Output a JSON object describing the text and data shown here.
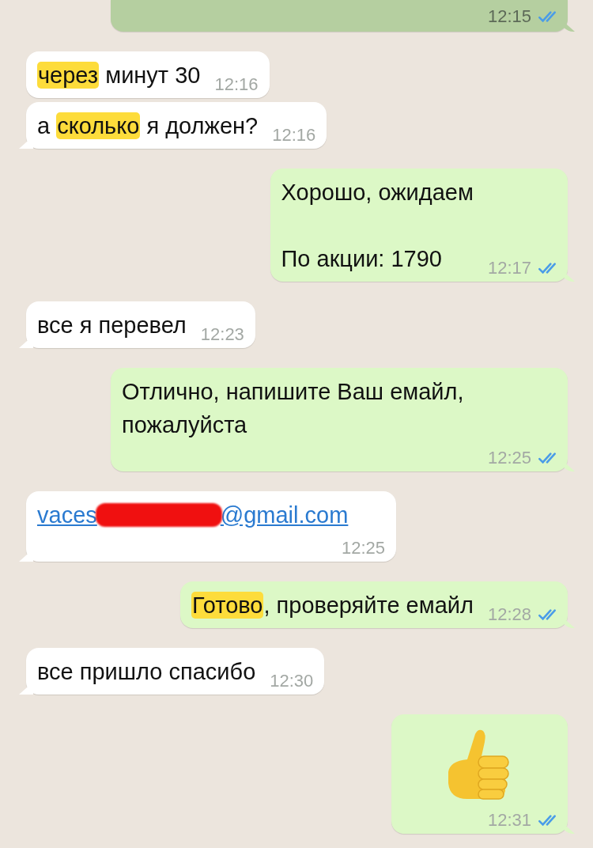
{
  "messages": [
    {
      "outgoing": true,
      "kind": "text",
      "selected": true,
      "time": "12:15",
      "read": true
    },
    {
      "outgoing": false,
      "kind": "text",
      "selected": false,
      "segments": [
        {
          "text": "через",
          "highlight": true
        },
        {
          "text": " минут 30",
          "highlight": false
        }
      ],
      "time": "12:16"
    },
    {
      "outgoing": false,
      "kind": "text",
      "selected": false,
      "segments": [
        {
          "text": "а ",
          "highlight": false
        },
        {
          "text": "сколько",
          "highlight": true
        },
        {
          "text": " я должен?",
          "highlight": false
        }
      ],
      "time": "12:16"
    },
    {
      "outgoing": true,
      "kind": "text",
      "selected": false,
      "segments": [
        {
          "text": "Хорошо, ожидаем\n\nПо акции: 1790",
          "highlight": false
        }
      ],
      "time": "12:17",
      "read": true
    },
    {
      "outgoing": false,
      "kind": "text",
      "selected": false,
      "segments": [
        {
          "text": "все я перевел",
          "highlight": false
        }
      ],
      "time": "12:23"
    },
    {
      "outgoing": true,
      "kind": "text",
      "selected": false,
      "segments": [
        {
          "text": "Отлично, напишите Ваш емайл, пожалуйста",
          "highlight": false
        }
      ],
      "time": "12:25",
      "read": true
    },
    {
      "outgoing": false,
      "kind": "link",
      "selected": false,
      "segments": [
        {
          "text": "vaces",
          "highlight": false
        },
        {
          "text": "@gmail.com",
          "highlight": false
        }
      ],
      "redacted": true,
      "time": "12:25"
    },
    {
      "outgoing": true,
      "kind": "text",
      "selected": false,
      "segments": [
        {
          "text": "Готово",
          "highlight": true
        },
        {
          "text": ", проверяйте емайл",
          "highlight": false
        }
      ],
      "time": "12:28",
      "read": true
    },
    {
      "outgoing": false,
      "kind": "text",
      "selected": false,
      "segments": [
        {
          "text": "все пришло спасибо",
          "highlight": false
        }
      ],
      "time": "12:30"
    },
    {
      "outgoing": true,
      "kind": "emoji",
      "selected": false,
      "time": "12:31",
      "read": true
    }
  ]
}
